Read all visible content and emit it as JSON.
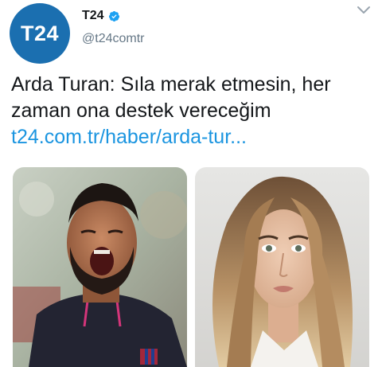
{
  "account": {
    "avatar_text": "T24",
    "display_name": "T24",
    "handle": "@t24comtr",
    "avatar_color": "#1b6fb0",
    "verified_color": "#1da1f2"
  },
  "tweet": {
    "text": "Arda Turan: Sıla merak etmesin, her zaman ona destek vereceğim",
    "link": "t24.com.tr/haber/arda-tur...",
    "link_color": "#1b95e0"
  },
  "media": [
    {
      "icon": "man-shouting-photo"
    },
    {
      "icon": "woman-portrait-photo"
    }
  ]
}
